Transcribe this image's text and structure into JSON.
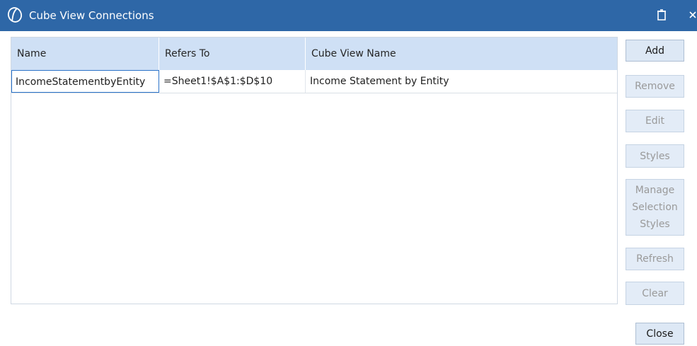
{
  "window": {
    "title": "Cube View Connections",
    "logo_icon": "onestream-logo-icon",
    "controls": [
      "maximize-icon",
      "close-icon"
    ],
    "accent_color": "#2e67a7"
  },
  "grid": {
    "columns": [
      "Name",
      "Refers To",
      "Cube View Name"
    ],
    "rows": [
      {
        "name": "IncomeStatementbyEntity",
        "refers_to": "=Sheet1!$A$1:$D$10",
        "cube_view_name": "Income Statement by Entity"
      }
    ]
  },
  "buttons": {
    "add": "Add",
    "remove": "Remove",
    "edit": "Edit",
    "styles": "Styles",
    "manage_selection_styles": "Manage\nSelection\nStyles",
    "refresh": "Refresh",
    "clear": "Clear",
    "close": "Close"
  }
}
